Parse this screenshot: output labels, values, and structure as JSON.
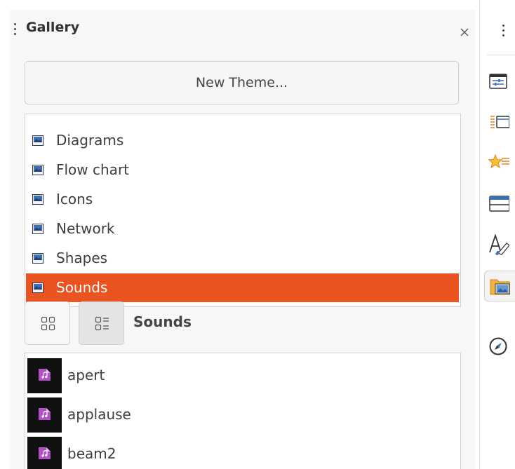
{
  "panel": {
    "title": "Gallery",
    "new_theme_label": "New Theme..."
  },
  "themes": {
    "items": [
      {
        "label": "Diagrams",
        "selected": false
      },
      {
        "label": "Flow chart",
        "selected": false
      },
      {
        "label": "Icons",
        "selected": false
      },
      {
        "label": "Network",
        "selected": false
      },
      {
        "label": "Shapes",
        "selected": false
      },
      {
        "label": "Sounds",
        "selected": true
      }
    ]
  },
  "view": {
    "mode": "detail",
    "current_theme": "Sounds"
  },
  "gallery_items": [
    {
      "label": "apert",
      "icon": "audio-file-icon"
    },
    {
      "label": "applause",
      "icon": "audio-file-icon"
    },
    {
      "label": "beam2",
      "icon": "audio-file-icon"
    }
  ],
  "tabbar": {
    "tabs": [
      {
        "name": "properties-tab",
        "icon": "properties-icon",
        "active": false
      },
      {
        "name": "page-tab",
        "icon": "slide-page-icon",
        "active": false
      },
      {
        "name": "animation-tab",
        "icon": "animation-star-icon",
        "active": false
      },
      {
        "name": "master-slides-tab",
        "icon": "master-slides-icon",
        "active": false
      },
      {
        "name": "styles-tab",
        "icon": "styles-icon",
        "active": false
      },
      {
        "name": "gallery-tab",
        "icon": "gallery-folder-icon",
        "active": true
      },
      {
        "name": "navigator-tab",
        "icon": "navigator-compass-icon",
        "active": false
      }
    ]
  },
  "colors": {
    "selection": "#e95420",
    "panel_bg": "#f7f7f7",
    "list_bg": "#ffffff",
    "thumb_bg": "#101010",
    "audio_icon": "#b24fc7"
  }
}
